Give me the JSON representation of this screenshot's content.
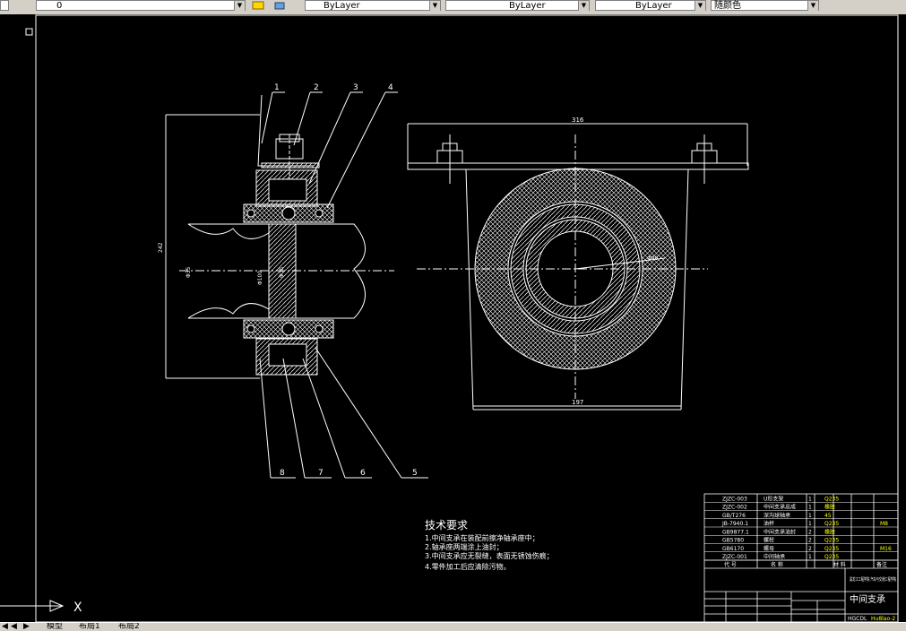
{
  "toolbar": {
    "layer_value": "0",
    "color_value": "ByLayer",
    "linetype_value": "ByLayer",
    "lineweight_value": "ByLayer",
    "plotstyle_value": "随颜色"
  },
  "drawing": {
    "balloons": [
      "1",
      "2",
      "3",
      "4",
      "5",
      "6",
      "7",
      "8"
    ],
    "dim_height": "242",
    "dim_top_width": "316",
    "dim_bottom_width": "197",
    "dim_shaft": "Φ35",
    "dim_bearing": "Φ100",
    "dim_inner": "Φ35",
    "dim_outer_dia": "Φ90",
    "ucs_label": "X"
  },
  "notes": {
    "title": "技术要求",
    "items": [
      "1.中间支承在装配前擦净轴承座中；",
      "2.轴承座两端涂上油封；",
      "3.中间支承应无裂缝，表面无锈蚀伤痕；",
      "4.零件加工后应清除污物。"
    ]
  },
  "title_block": {
    "drawing_name": "中间支承",
    "school": "黑龙江工程学院 汽车与交通工程学院",
    "drawing_no": "HGCDL",
    "drawing_no_suffix": "Hu8lao-2",
    "header": [
      "代 号",
      "名 称",
      "材 料",
      "备注"
    ],
    "bom": [
      {
        "code": "ZJZC-003",
        "name": "U形支架",
        "qty": "1",
        "mat": "Q235",
        "note": ""
      },
      {
        "code": "ZJZC-002",
        "name": "中间支承总成",
        "qty": "1",
        "mat": "橡胶",
        "note": ""
      },
      {
        "code": "GB/T276",
        "name": "深沟球轴承",
        "qty": "1",
        "mat": "45",
        "note": ""
      },
      {
        "code": "JB-7940.1",
        "name": "油杯",
        "qty": "1",
        "mat": "Q235",
        "note": "M8"
      },
      {
        "code": "GB9877.1",
        "name": "中间支承油封",
        "qty": "2",
        "mat": "橡胶",
        "note": ""
      },
      {
        "code": "GB5780",
        "name": "螺栓",
        "qty": "2",
        "mat": "Q235",
        "note": ""
      },
      {
        "code": "GB6170",
        "name": "螺母",
        "qty": "2",
        "mat": "Q235",
        "note": "M16"
      },
      {
        "code": "ZJZC-001",
        "name": "中间轴承",
        "qty": "1",
        "mat": "Q235",
        "note": ""
      }
    ]
  },
  "tabs": [
    "模型",
    "布局1",
    "布局2"
  ],
  "colors": {
    "background": "#000000",
    "line_white": "#ffffff",
    "text_yellow": "#ffff00",
    "ui_gray": "#d4d0c8"
  }
}
